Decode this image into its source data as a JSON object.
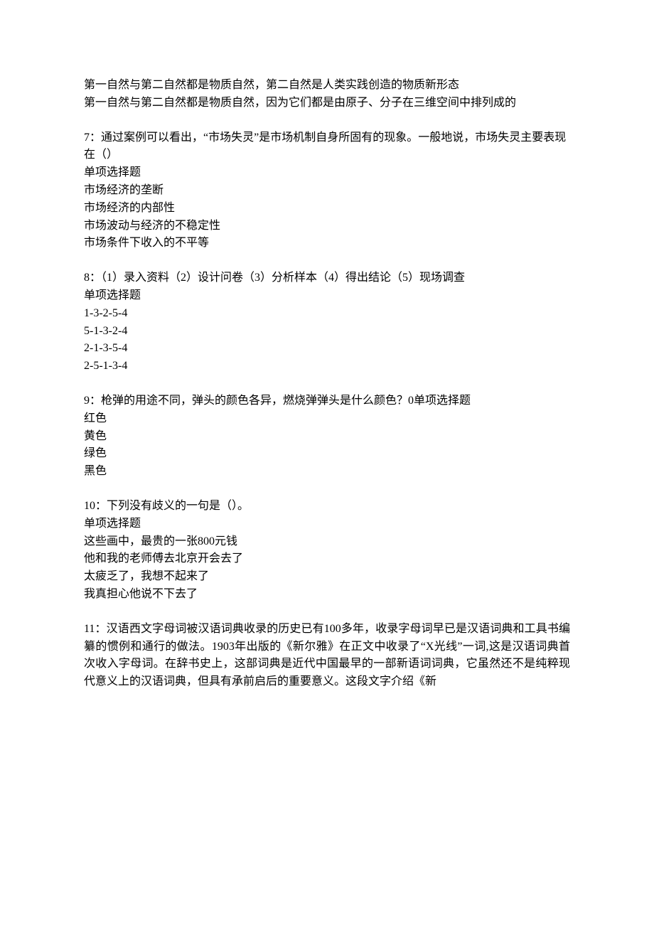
{
  "q6_remainder": {
    "options": [
      "第一自然与第二自然都是物质自然，第二自然是人类实践创造的物质新形态",
      "第一自然与第二自然都是物质自然，因为它们都是由原子、分子在三维空间中排列成的"
    ]
  },
  "q7": {
    "stem": "7：通过案例可以看出，“市场失灵”是市场机制自身所固有的现象。一般地说，市场失灵主要表现在（）",
    "type": "单项选择题",
    "options": [
      "市场经济的垄断",
      "市场经济的内部性",
      "市场波动与经济的不稳定性",
      "市场条件下收入的不平等"
    ]
  },
  "q8": {
    "stem": "8：（1）录入资料（2）设计问卷（3）分析样本（4）得出结论（5）现场调查",
    "type": "单项选择题",
    "options": [
      "1-3-2-5-4",
      "5-1-3-2-4",
      "2-1-3-5-4",
      "2-5-1-3-4"
    ]
  },
  "q9": {
    "stem": "9：枪弹的用途不同，弹头的颜色各异，燃烧弹弹头是什么颜色？0单项选择题",
    "options": [
      "红色",
      "黄色",
      "绿色",
      "黑色"
    ]
  },
  "q10": {
    "stem": "10：下列没有歧义的一句是（）。",
    "type": "单项选择题",
    "options": [
      "这些画中，最贵的一张800元钱",
      "他和我的老师傅去北京开会去了",
      "太疲乏了，我想不起来了",
      "我真担心他说不下去了"
    ]
  },
  "q11": {
    "stem": "11：汉语西文字母词被汉语词典收录的历史已有100多年，收录字母词早已是汉语词典和工具书编纂的惯例和通行的做法。1903年出版的《新尔雅》在正文中收录了“X光线”一词,这是汉语词典首次收入字母词。在辞书史上，这部词典是近代中国最早的一部新语词词典，它虽然还不是纯粹现代意义上的汉语词典，但具有承前启后的重要意义。这段文字介绍《新"
  }
}
